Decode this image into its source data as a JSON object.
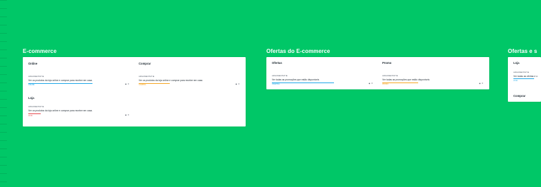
{
  "colors": {
    "background": "#00c767",
    "board": "#ffffff",
    "accent_blue": "#1ea7e8",
    "accent_orange": "#f5a623",
    "accent_red": "#e5484d"
  },
  "sections": [
    {
      "title": "E-commerce",
      "cards": [
        {
          "title": "Online",
          "kicker": "ARGUMENTATIE",
          "desc": "Ver os produtos da loja online e comprar para receber em casa.",
          "tag": "ONLINE",
          "icon": "eye-icon",
          "count": "0",
          "line_color": "#1ea7e8"
        },
        {
          "title": "Comprar",
          "kicker": "ARGUMENTATIE",
          "desc": "Ver os produtos da loja online e comprar para receber em casa.",
          "tag": "COMPRA",
          "icon": "",
          "count": "",
          "line_color": "#f5a623"
        },
        {
          "title": "Loja",
          "kicker": "ARGUMENTATIE",
          "desc": "Ver os produtos da loja online e comprar para receber em casa.",
          "tag": "LOJA",
          "icon": "eye-icon",
          "count": "0",
          "line_color": "#e5484d"
        }
      ]
    },
    {
      "title": "Ofertas do E-commerce",
      "cards": [
        {
          "title": "Ofertas",
          "kicker": "ARGUMENTATIE",
          "desc": "Ver todas as promoções que estão disponíveis",
          "tag": "OFERTAS",
          "icon": "eye-icon",
          "count": "0",
          "line_color": "#1ea7e8"
        },
        {
          "title": "Promo",
          "kicker": "ARGUMENTATIE",
          "desc": "Ver todas as promoções que estão disponíveis",
          "tag": "PROMO",
          "icon": "eye-icon",
          "count": "0",
          "line_color": "#f5a623"
        }
      ]
    },
    {
      "title": "Ofertas e s",
      "cards": [
        {
          "title": "Loja",
          "kicker": "ARGUMENTATIE",
          "desc": "Ver todas as ofertas e o",
          "tag": "LOJA",
          "icon": "",
          "count": "",
          "line_color": "#1ea7e8"
        },
        {
          "title": "Comprar",
          "kicker": "",
          "desc": "",
          "tag": "",
          "icon": "",
          "count": "",
          "line_color": ""
        }
      ]
    }
  ]
}
